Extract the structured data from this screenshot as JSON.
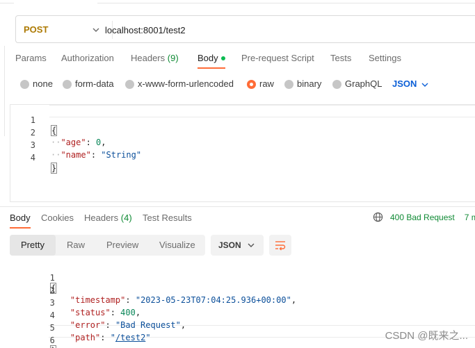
{
  "request": {
    "method": "POST",
    "url": "localhost:8001/test2",
    "tabs": [
      {
        "label": "Params"
      },
      {
        "label": "Authorization"
      },
      {
        "label": "Headers",
        "count": "(9)"
      },
      {
        "label": "Body"
      },
      {
        "label": "Pre-request Script"
      },
      {
        "label": "Tests"
      },
      {
        "label": "Settings"
      }
    ],
    "active_tab": "Body",
    "body_types": [
      "none",
      "form-data",
      "x-www-form-urlencoded",
      "raw",
      "binary",
      "GraphQL"
    ],
    "selected_body_type": "raw",
    "language": "JSON",
    "editor": {
      "line_numbers": [
        "1",
        "2",
        "3",
        "4"
      ],
      "lines": [
        "{",
        "\"age\"",
        "0",
        "\"name\"",
        "\"String\"",
        "}"
      ]
    }
  },
  "response": {
    "tabs": [
      {
        "label": "Body"
      },
      {
        "label": "Cookies"
      },
      {
        "label": "Headers",
        "count": "(4)"
      },
      {
        "label": "Test Results"
      }
    ],
    "active_tab": "Body",
    "status": "400 Bad Request",
    "time": "7 m",
    "views": [
      "Pretty",
      "Raw",
      "Preview",
      "Visualize"
    ],
    "active_view": "Pretty",
    "format": "JSON",
    "editor": {
      "line_numbers": [
        "1",
        "2",
        "3",
        "4",
        "5",
        "6"
      ],
      "keys": [
        "\"timestamp\"",
        "\"status\"",
        "\"error\"",
        "\"path\""
      ],
      "values": [
        "\"2023-05-23T07:04:25.936+00:00\"",
        "400",
        "\"Bad Request\"",
        "\"/test2\""
      ],
      "open_brace": "{",
      "close_brace": "}"
    }
  },
  "watermark": "CSDN @既来之...",
  "colors": {
    "method": "#ad7a03",
    "accent": "#ff6c37",
    "success_count": "#0f8a34",
    "json_key": "#b02222",
    "json_string": "#0b4f9a",
    "json_number": "#098658",
    "link_blue": "#0b5fd7"
  },
  "icons": {
    "method_dropdown": "chevron-down-icon",
    "language_dropdown": "chevron-down-icon",
    "status_globe": "globe-icon",
    "wrap_lines": "wrap-lines-icon"
  }
}
